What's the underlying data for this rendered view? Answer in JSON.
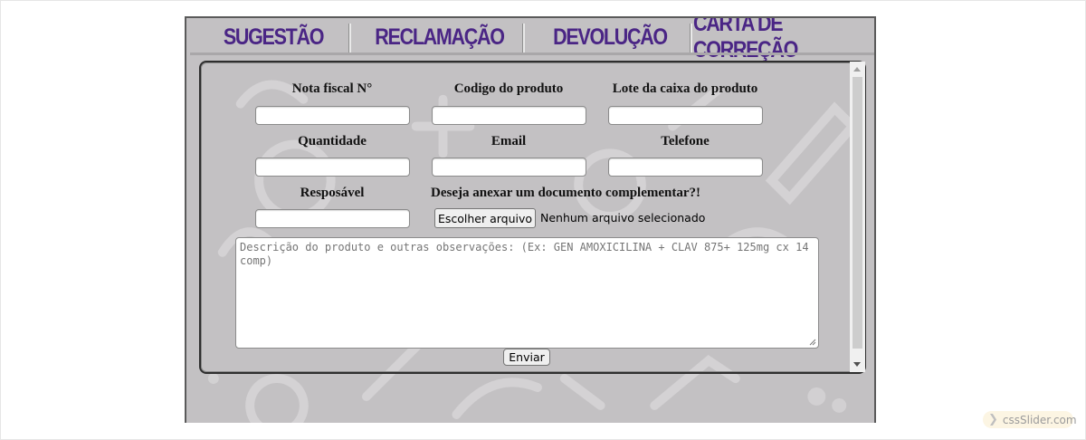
{
  "tabs": [
    {
      "label": "SUGESTÃO"
    },
    {
      "label": "RECLAMAÇÃO"
    },
    {
      "label": "DEVOLUÇÃO"
    },
    {
      "label": "CARTA DE CORREÇÃO"
    }
  ],
  "form": {
    "nota_fiscal_label": "Nota fiscal N°",
    "codigo_label": "Codigo do produto",
    "lote_label": "Lote da caixa do produto",
    "quantidade_label": "Quantidade",
    "email_label": "Email",
    "telefone_label": "Telefone",
    "responsavel_label": "Resposável",
    "anexo_label": "Deseja anexar um documento complementar?!",
    "file_button_label": "Escolher arquivo",
    "file_status": "Nenhum arquivo selecionado",
    "descricao_placeholder": "Descrição do produto e outras observações: (Ex: GEN AMOXICILINA + CLAV 875+ 125mg cx 14 comp)",
    "send_label": "Enviar"
  },
  "badge": {
    "label": "cssSlider.com",
    "icon": "chevron-right-icon"
  },
  "colors": {
    "tab_text": "#4a2585",
    "panel_bg": "#c3c1c3",
    "badge_bg": "#fcf5e3"
  }
}
